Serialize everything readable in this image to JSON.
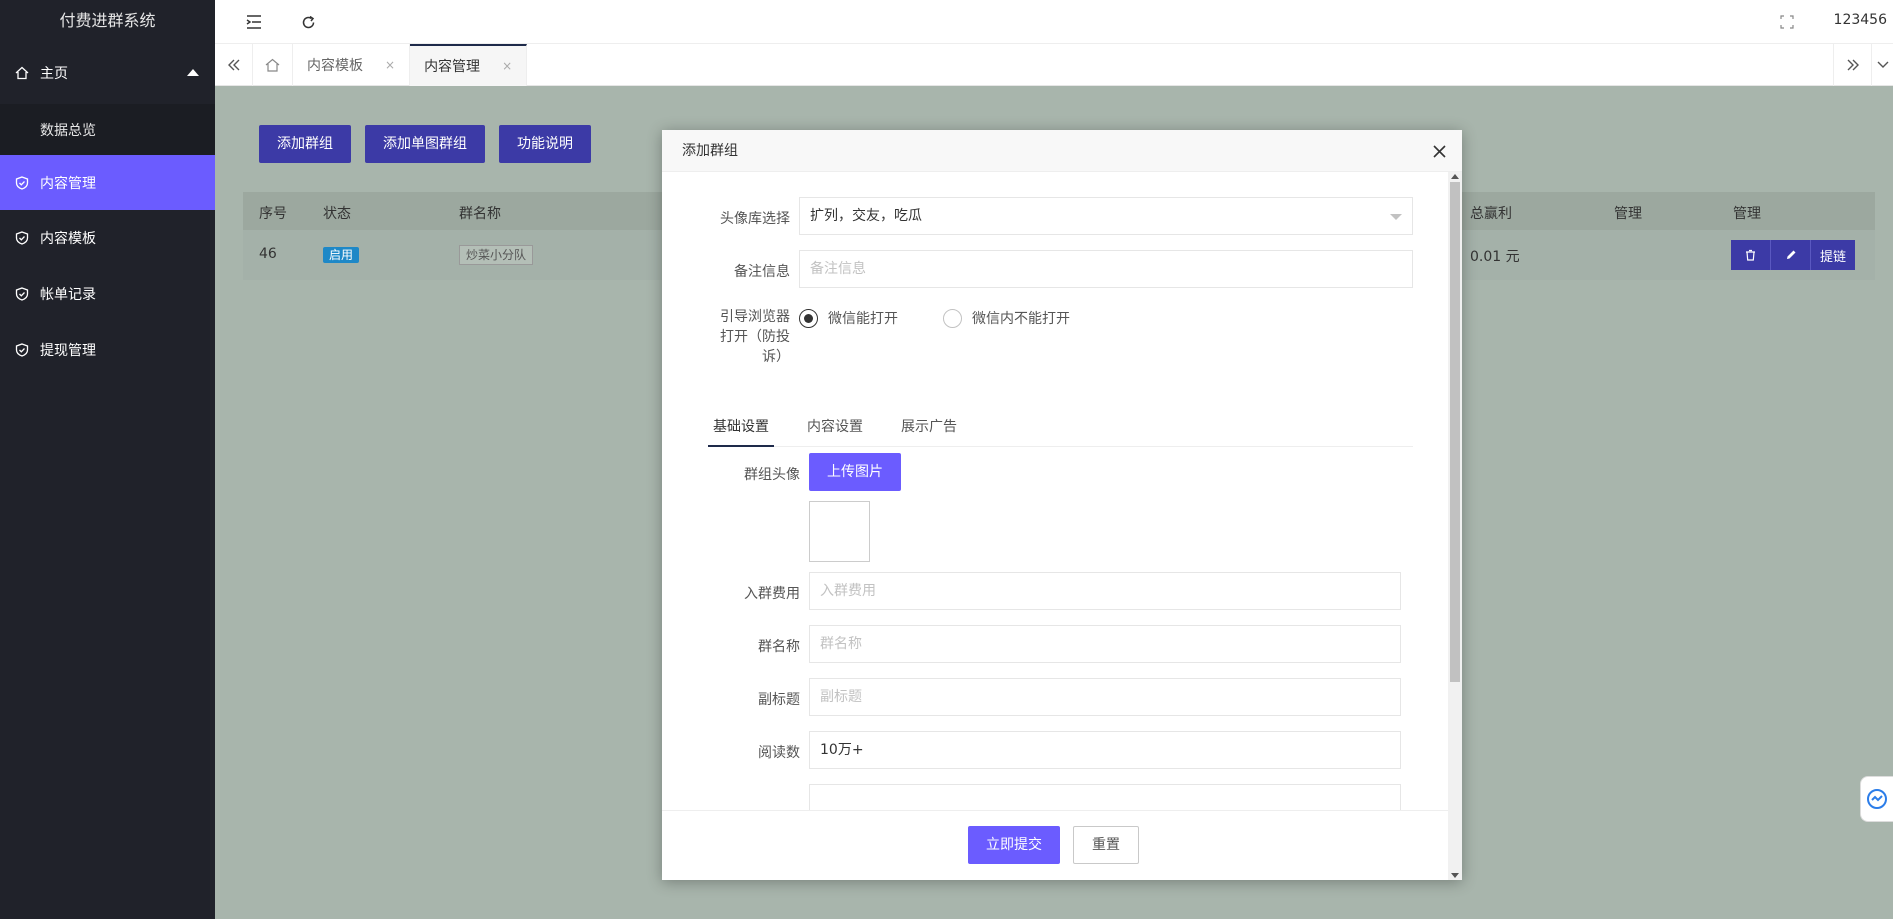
{
  "app": {
    "title": "付费进群系统"
  },
  "sidebar": {
    "items": [
      {
        "label": "主页",
        "icon": "home-icon"
      },
      {
        "label": "数据总览"
      },
      {
        "label": "内容管理",
        "icon": "shield-check-icon"
      },
      {
        "label": "内容模板",
        "icon": "shield-check-icon"
      },
      {
        "label": "帐单记录",
        "icon": "shield-check-icon"
      },
      {
        "label": "提现管理",
        "icon": "shield-check-icon"
      }
    ]
  },
  "header": {
    "user": "123456"
  },
  "tabs": [
    {
      "label": "内容模板",
      "close": "×"
    },
    {
      "label": "内容管理",
      "close": "×"
    }
  ],
  "toolbar": {
    "add_group": "添加群组",
    "add_single": "添加单图群组",
    "help": "功能说明"
  },
  "grid": {
    "columns": [
      "序号",
      "状态",
      "群名称",
      "总赢利",
      "管理",
      "管理"
    ],
    "rows": [
      {
        "id": "46",
        "status": "启用",
        "name": "炒菜小分队",
        "profit": "0.01 元",
        "action_extract": "提链"
      }
    ]
  },
  "modal": {
    "title": "添加群组",
    "avatar_lib_label": "头像库选择",
    "avatar_lib_value": "扩列，交友，吃瓜",
    "remark_label": "备注信息",
    "remark_placeholder": "备注信息",
    "browser_label_l1": "引导浏览器",
    "browser_label_l2": "打开（防投",
    "browser_label_l3": "诉）",
    "radio_yes": "微信能打开",
    "radio_no": "微信内不能打开",
    "tabs": [
      "基础设置",
      "内容设置",
      "展示广告"
    ],
    "group_avatar_label": "群组头像",
    "upload_label": "上传图片",
    "fee_label": "入群费用",
    "fee_placeholder": "入群费用",
    "name_label": "群名称",
    "name_placeholder": "群名称",
    "subtitle_label": "副标题",
    "subtitle_placeholder": "副标题",
    "reads_label": "阅读数",
    "reads_value": "10万+",
    "submit": "立即提交",
    "reset": "重置"
  },
  "colors": {
    "accent": "#6b5cff",
    "sidebar_bg": "#20222a",
    "overlay": "#a8b5ac"
  }
}
